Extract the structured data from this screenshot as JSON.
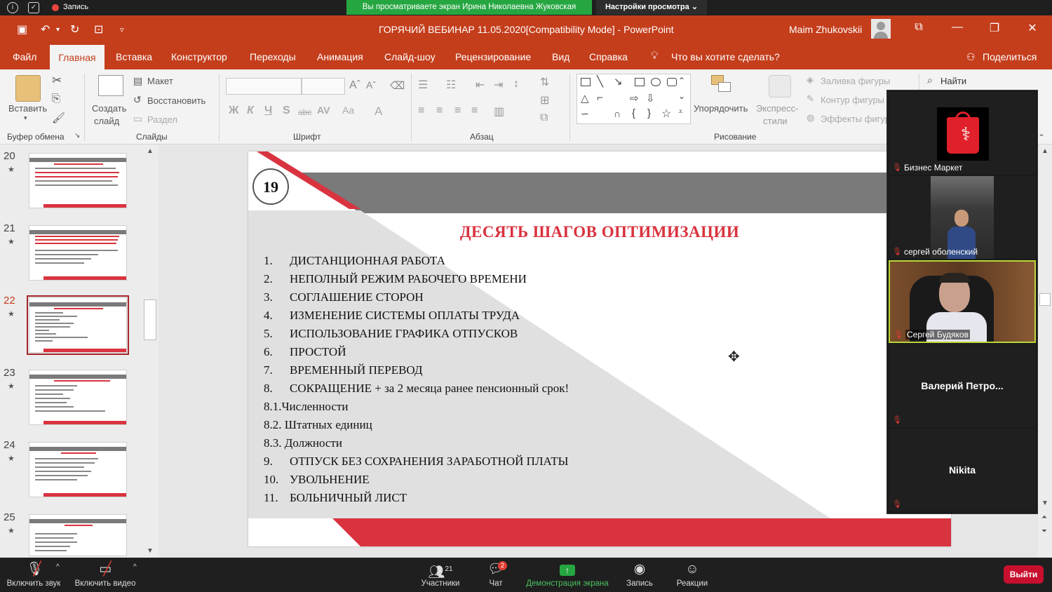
{
  "zoom_top": {
    "recording_label": "Запись",
    "share_banner": "Вы просматриваете экран Ирина Николаевна Жуковская",
    "view_settings": "Настройки просмотра ⌄"
  },
  "titlebar": {
    "doc_title": "ГОРЯЧИЙ ВЕБИНАР 11.05.2020[Compatibility Mode]  -  PowerPoint",
    "user_name": "Maim Zhukovskii"
  },
  "menu": {
    "file": "Файл",
    "home": "Главная",
    "insert": "Вставка",
    "design": "Конструктор",
    "transitions": "Переходы",
    "animation": "Анимация",
    "slideshow": "Слайд-шоу",
    "review": "Рецензирование",
    "view": "Вид",
    "help": "Справка",
    "tell_me": "Что вы хотите сделать?",
    "share": "Поделиться"
  },
  "ribbon": {
    "paste": "Вставить",
    "clipboard_group": "Буфер обмена",
    "new_slide_1": "Создать",
    "new_slide_2": "слайд",
    "layout": "Макет",
    "reset": "Восстановить",
    "section": "Раздел",
    "slides_group": "Слайды",
    "font_group": "Шрифт",
    "paragraph_group": "Абзац",
    "arrange": "Упорядочить",
    "quick_styles_1": "Экспресс-",
    "quick_styles_2": "стили",
    "shape_fill": "Заливка фигуры",
    "shape_outline": "Контур фигуры",
    "shape_effects": "Эффекты фигур",
    "drawing_group": "Рисование",
    "find": "Найти"
  },
  "thumbnails": [
    {
      "num": "20"
    },
    {
      "num": "21"
    },
    {
      "num": "22"
    },
    {
      "num": "23"
    },
    {
      "num": "24"
    },
    {
      "num": "25"
    }
  ],
  "slide": {
    "number": "19",
    "title": "ДЕСЯТЬ  ШАГОВ ОПТИМИЗАЦИИ",
    "items": [
      {
        "n": "1.",
        "text": "ДИСТАНЦИОННАЯ РАБОТА"
      },
      {
        "n": "2.",
        "text": "НЕПОЛНЫЙ РЕЖИМ РАБОЧЕГО ВРЕМЕНИ"
      },
      {
        "n": "3.",
        "text": "СОГЛАШЕНИЕ СТОРОН"
      },
      {
        "n": "4.",
        "text": "ИЗМЕНЕНИЕ СИСТЕМЫ ОПЛАТЫ ТРУДА"
      },
      {
        "n": "5.",
        "text": "ИСПОЛЬЗОВАНИЕ ГРАФИКА ОТПУСКОВ"
      },
      {
        "n": "6.",
        "text": "ПРОСТОЙ"
      },
      {
        "n": "7.",
        "text": "ВРЕМЕННЫЙ ПЕРЕВОД"
      },
      {
        "n": "8.",
        "text": "СОКРАЩЕНИЕ + за 2 месяца ранее пенсионный срок!"
      },
      {
        "n": "",
        "text": "8.1.Численности"
      },
      {
        "n": "",
        "text": "8.2. Штатных единиц"
      },
      {
        "n": "",
        "text": "8.3. Должности"
      },
      {
        "n": "9.",
        "text": "ОТПУСК БЕЗ СОХРАНЕНИЯ ЗАРАБОТНОЙ ПЛАТЫ"
      },
      {
        "n": "10.",
        "text": "УВОЛЬНЕНИЕ"
      },
      {
        "n": "11.",
        "text": "БОЛЬНИЧНЫЙ ЛИСТ"
      }
    ]
  },
  "participants": [
    {
      "name": "Бизнес Маркет"
    },
    {
      "name": "сергей оболенский"
    },
    {
      "name": "Сергей Будяков"
    },
    {
      "name": "Валерий  Петро..."
    },
    {
      "name": "Nikita"
    }
  ],
  "zoom_bottom": {
    "unmute": "Включить звук",
    "start_video": "Включить видео",
    "participants": "Участники",
    "participants_count": "21",
    "chat": "Чат",
    "chat_badge": "2",
    "share_screen": "Демонстрация экрана",
    "record": "Запись",
    "reactions": "Реакции",
    "leave": "Выйти"
  },
  "colors": {
    "powerpoint_accent": "#c43e1c",
    "slide_red": "#d9333f",
    "zoom_green": "#26a641",
    "leave_red": "#c8102e"
  }
}
